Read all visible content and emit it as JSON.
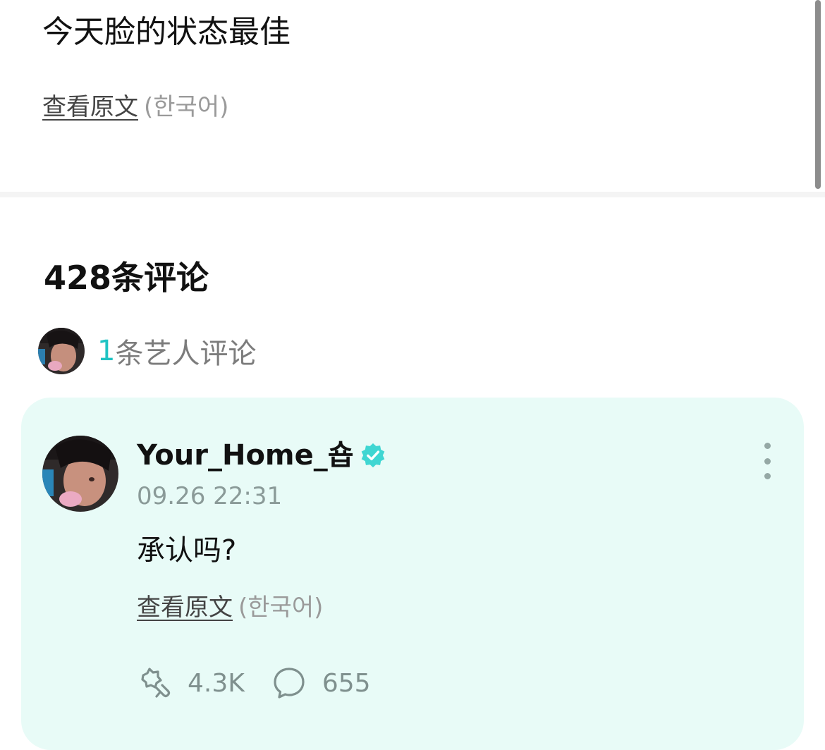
{
  "post": {
    "text": "今天脸的状态最佳",
    "view_original": "查看原文",
    "language": "(한국어)"
  },
  "comments": {
    "title": "428条评论",
    "artist_count": "1",
    "artist_label": "条艺人评论"
  },
  "comment": {
    "username": "Your_Home_숍",
    "timestamp": "09.26 22:31",
    "text": "承认吗?",
    "view_original": "查看原文",
    "language": "(한국어)",
    "likes": "4.3K",
    "replies": "655"
  },
  "colors": {
    "accent": "#1fc3c3",
    "card_bg": "#e8fbf7",
    "verified": "#3fd6d2"
  }
}
